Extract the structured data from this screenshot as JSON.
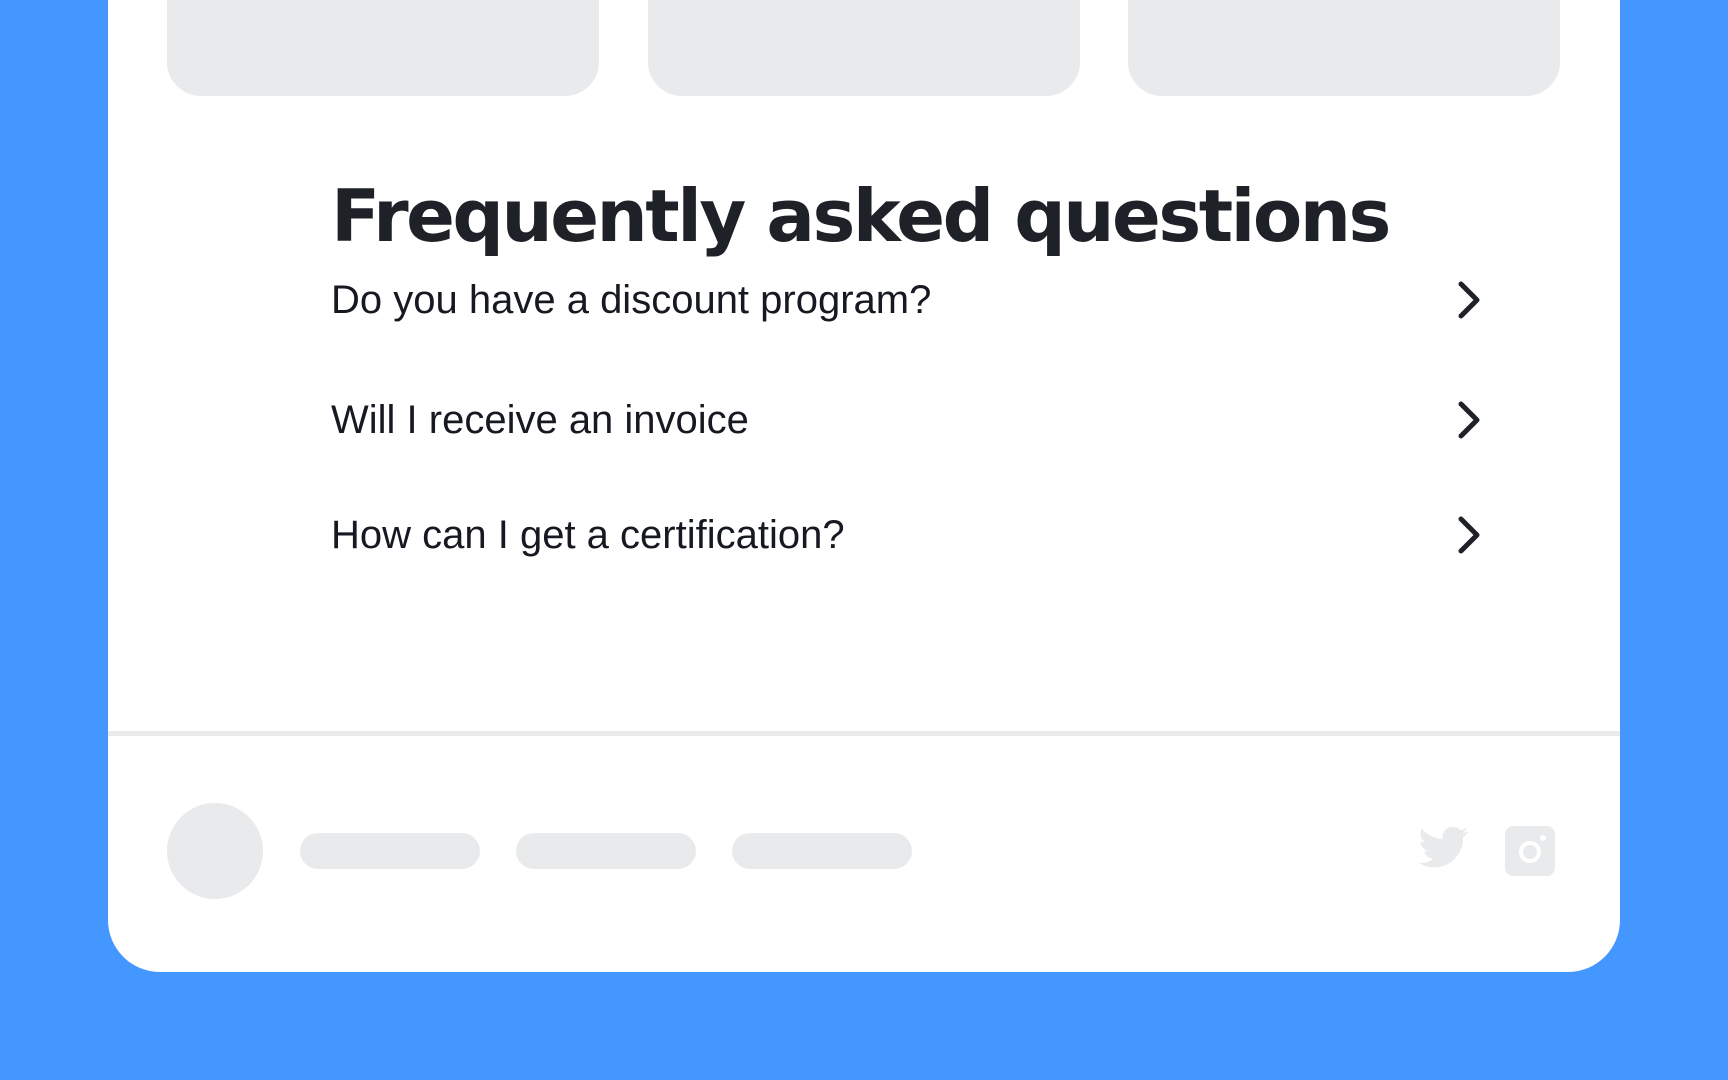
{
  "faq": {
    "title": "Frequently asked questions",
    "items": [
      {
        "question": "Do you have a discount program?",
        "icon": "chevron-right-icon"
      },
      {
        "question": "Will I receive an invoice",
        "icon": "chevron-right-icon"
      },
      {
        "question": "How can I get a certification?",
        "icon": "chevron-right-icon"
      }
    ]
  },
  "footer": {
    "social": [
      "twitter-icon",
      "instagram-icon"
    ]
  },
  "colors": {
    "background": "#4397fe",
    "card": "#ffffff",
    "placeholder": "#e9eaec",
    "text": "#1f2129"
  }
}
